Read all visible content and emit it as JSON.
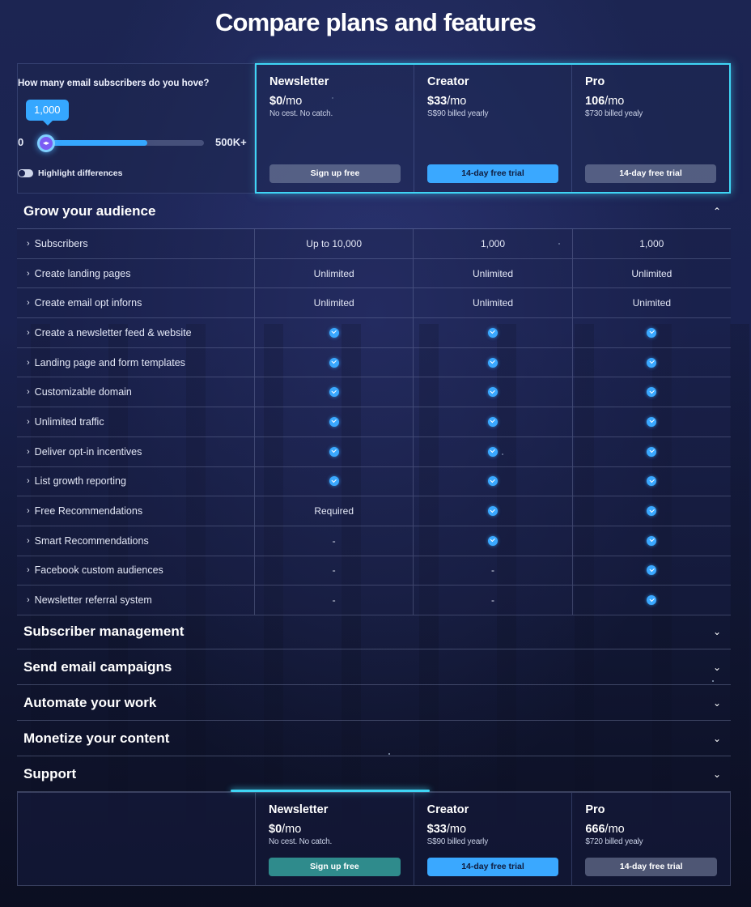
{
  "page": {
    "title": "Compare plans and features"
  },
  "slider": {
    "question": "How many email subscribers do you hove?",
    "value_label": "1,000",
    "min_label": "0",
    "max_label": "500K+",
    "fill_fraction": 0.66
  },
  "toggle": {
    "label": "Highlight differences",
    "on": false
  },
  "plans_top": [
    {
      "name": "Newsletter",
      "price": "$0",
      "unit": "/mo",
      "note": "No cest. No catch.",
      "button": "Sign up free"
    },
    {
      "name": "Creator",
      "price": "$33",
      "unit": "/mo",
      "note": "S$90 billed yearly",
      "button": "14-day free trial"
    },
    {
      "name": "Pro",
      "price": "106",
      "unit": "/mo",
      "note": "$730 billed yealy",
      "button": "14-day free trial"
    }
  ],
  "grow": {
    "title": "Grow your audience",
    "rows": [
      {
        "feature": "Subscribers",
        "cells": [
          "Up to 10,000",
          "1,000",
          "1,000"
        ]
      },
      {
        "feature": "Create landing pages",
        "cells": [
          "Unlimited",
          "Unlimited",
          "Unlimited"
        ]
      },
      {
        "feature": "Create email opt inforns",
        "cells": [
          "Unlimited",
          "Unlimited",
          "Unimited"
        ]
      },
      {
        "feature": "Create a newsletter feed & website",
        "cells": [
          "check",
          "check",
          "check"
        ]
      },
      {
        "feature": "Landing page and form templates",
        "cells": [
          "check",
          "check",
          "check"
        ]
      },
      {
        "feature": "Customizable domain",
        "cells": [
          "check",
          "check",
          "check"
        ]
      },
      {
        "feature": "Unlimited traffic",
        "cells": [
          "check",
          "check",
          "check"
        ]
      },
      {
        "feature": "Deliver opt-in incentives",
        "cells": [
          "check",
          "check",
          "check"
        ]
      },
      {
        "feature": "List growth reporting",
        "cells": [
          "check",
          "check",
          "check"
        ]
      },
      {
        "feature": "Free Recommendations",
        "cells": [
          "Required",
          "check",
          "check"
        ]
      },
      {
        "feature": "Smart Recommendations",
        "cells": [
          "-",
          "check",
          "check"
        ]
      },
      {
        "feature": "Facebook custom audiences",
        "cells": [
          "-",
          "-",
          "check"
        ]
      },
      {
        "feature": "Newsletter referral system",
        "cells": [
          "-",
          "-",
          "check"
        ]
      }
    ]
  },
  "sections": [
    {
      "title": "Subscriber management"
    },
    {
      "title": "Send email campaigns"
    },
    {
      "title": "Automate your work"
    },
    {
      "title": "Monetize your content"
    },
    {
      "title": "Support"
    }
  ],
  "plans_bottom": [
    {
      "name": "Newsletter",
      "price": "$0",
      "unit": "/mo",
      "note": "No cest. No catch.",
      "button": "Sign up free"
    },
    {
      "name": "Creator",
      "price": "$33",
      "unit": "/mo",
      "note": "S$90 billed yearly",
      "button": "14-day free trial"
    },
    {
      "name": "Pro",
      "price": "666",
      "unit": "/mo",
      "note": "$720 billed yealy",
      "button": "14-day free trial"
    }
  ],
  "icons": {
    "expanded": "chevron-up-icon",
    "collapsed": "chevron-down-icon",
    "row": "chevron-right-icon",
    "included": "check-circle-icon"
  },
  "colors": {
    "accent": "#3aa8ff",
    "glow": "#3fd5f5",
    "knob": "#7b5cf4"
  }
}
